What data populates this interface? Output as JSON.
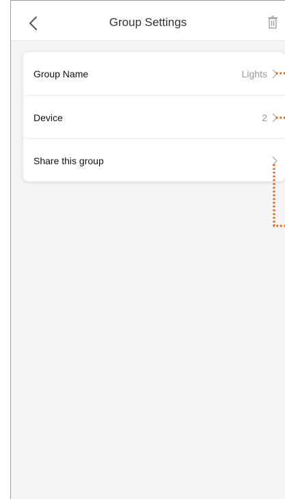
{
  "header": {
    "title": "Group Settings",
    "back_icon": "chevron-left-icon",
    "delete_icon": "trash-icon"
  },
  "settings": {
    "rows": [
      {
        "label": "Group Name",
        "value": "Lights"
      },
      {
        "label": "Device",
        "value": "2"
      },
      {
        "label": "Share this group",
        "value": ""
      }
    ]
  },
  "colors": {
    "annotation": "#e8590c",
    "background": "#f4f4f4",
    "card": "#ffffff"
  }
}
